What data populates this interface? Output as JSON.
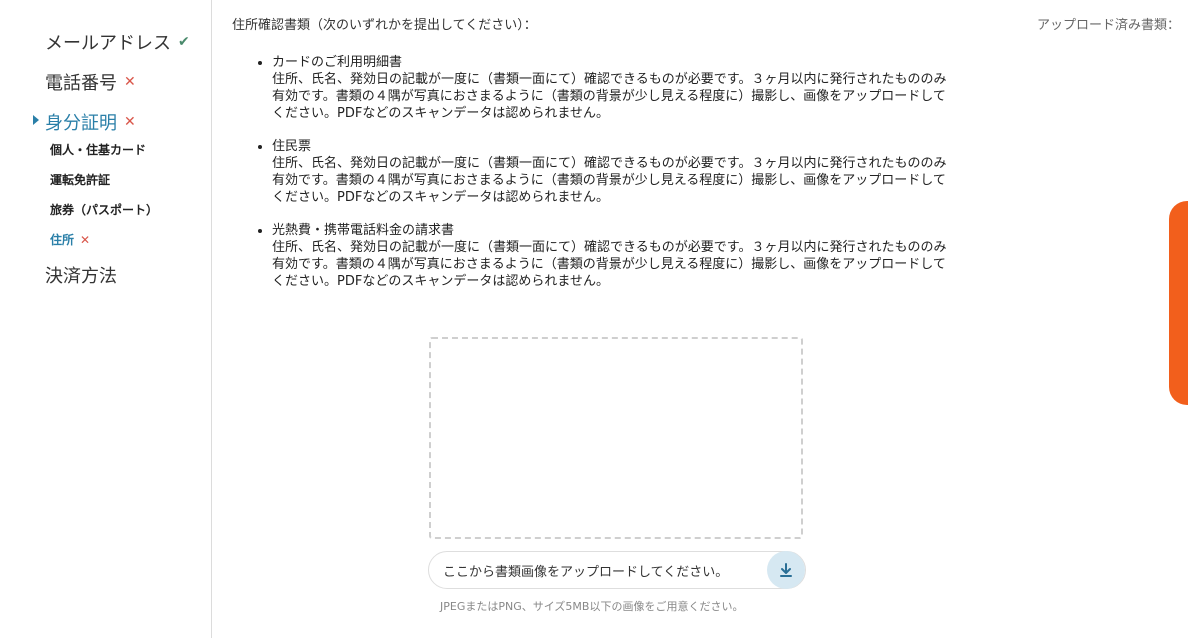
{
  "sidebar": {
    "items": [
      {
        "label": "メールアドレス",
        "status": "✔"
      },
      {
        "label": "電話番号",
        "status": "✕"
      },
      {
        "label": "身分証明",
        "status": "✕"
      },
      {
        "label": "決済方法"
      }
    ],
    "sub_items": [
      {
        "label": "個人・住基カード"
      },
      {
        "label": "運転免許証"
      },
      {
        "label": "旅券（パスポート）"
      },
      {
        "label": "住所",
        "status": "✕"
      }
    ]
  },
  "main": {
    "heading": "住所確認書類（次のいずれかを提出してください）：",
    "uploaded_label": "アップロード済み書類：",
    "documents": [
      {
        "title": "カードのご利用明細書",
        "desc_line1": "住所、氏名、発効日の記載が一度に（書類一面にて）確認できるものが必要です。３ヶ月以内に発行されたもののみ",
        "desc_line2": "有効です。書類の４隅が写真におさまるように（書類の背景が少し見える程度に）撮影し、画像をアップロードして",
        "desc_line3": "ください。PDFなどのスキャンデータは認められません。"
      },
      {
        "title": "住民票",
        "desc_line1": "住所、氏名、発効日の記載が一度に（書類一面にて）確認できるものが必要です。３ヶ月以内に発行されたもののみ",
        "desc_line2": "有効です。書類の４隅が写真におさまるように（書類の背景が少し見える程度に）撮影し、画像をアップロードして",
        "desc_line3": "ください。PDFなどのスキャンデータは認められません。"
      },
      {
        "title": "光熱費・携帯電話料金の請求書",
        "desc_line1": "住所、氏名、発効日の記載が一度に（書類一面にて）確認できるものが必要です。３ヶ月以内に発行されたもののみ",
        "desc_line2": "有効です。書類の４隅が写真におさまるように（書類の背景が少し見える程度に）撮影し、画像をアップロードして",
        "desc_line3": "ください。PDFなどのスキャンデータは認められません。"
      }
    ],
    "upload_prompt": "ここから書類画像をアップロードしてください。",
    "upload_hint": "JPEGまたはPNG、サイズ5MB以下の画像をご用意ください。"
  },
  "colors": {
    "accent": "#2a7fa8",
    "ok": "#4a8a6c",
    "ng": "#d9564a",
    "side_tab": "#f25f1c"
  },
  "icons": {
    "verified": "check-icon",
    "missing": "cross-icon",
    "upload": "download-arrow-icon",
    "current": "caret-right-icon"
  }
}
